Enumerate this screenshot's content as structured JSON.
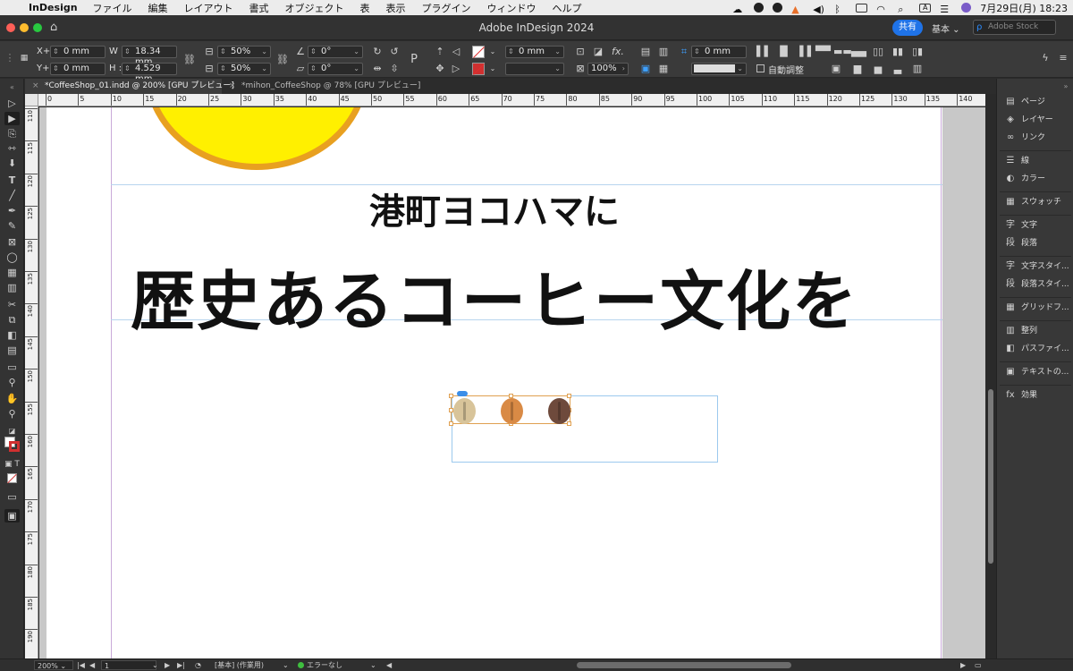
{
  "menubar": {
    "app_name": "InDesign",
    "items": [
      "ファイル",
      "編集",
      "レイアウト",
      "書式",
      "オブジェクト",
      "表",
      "表示",
      "プラグイン",
      "ウィンドウ",
      "ヘルプ"
    ],
    "input_indicator": "A",
    "datetime": "7月29日(月)  18:23"
  },
  "titlebar": {
    "title": "Adobe InDesign 2024",
    "share_label": "共有",
    "workspace": "基本",
    "stock_placeholder": "Adobe Stock"
  },
  "control": {
    "x_label": "X+",
    "x_value": "0 mm",
    "y_label": "Y+",
    "y_value": "0 mm",
    "w_label": "W :",
    "w_value": "18.34 mm",
    "h_label": "H :",
    "h_value": "4.529 mm",
    "scale_x": "50%",
    "scale_y": "50%",
    "rotate": "0°",
    "shear": "0°",
    "stroke_weight": "0 mm",
    "frame_weight": "0 mm",
    "opacity": "100%",
    "auto_fit_label": "自動調整"
  },
  "tabs": [
    {
      "label": "*CoffeeShop_01.indd @ 200% [GPU プレビュー]",
      "active": true
    },
    {
      "label": "*mihon_CoffeeShop @ 78% [GPU プレビュー]",
      "active": false
    }
  ],
  "ruler_top": [
    "0",
    "5",
    "10",
    "15",
    "20",
    "25",
    "30",
    "35",
    "40",
    "45",
    "50",
    "55",
    "60",
    "65",
    "70",
    "75",
    "80",
    "85",
    "90",
    "95",
    "100",
    "105",
    "110",
    "115",
    "120",
    "125",
    "130",
    "135",
    "140"
  ],
  "ruler_left": [
    "110",
    "115",
    "120",
    "125",
    "130",
    "135",
    "140",
    "145",
    "150",
    "155",
    "160",
    "165",
    "170",
    "175",
    "180",
    "185",
    "190"
  ],
  "document": {
    "heading_small": "港町ヨコハマに",
    "heading_large": "歴史あるコーヒー文化を",
    "bean_colors": [
      "#d8c49a",
      "#d98a45",
      "#6e4a3c"
    ],
    "sun_fill": "#fff000",
    "sun_stroke": "#e8a020"
  },
  "panels": [
    {
      "icon": "pages-icon",
      "glyph": "▤",
      "label": "ページ"
    },
    {
      "icon": "layers-icon",
      "glyph": "◈",
      "label": "レイヤー"
    },
    {
      "icon": "links-icon",
      "glyph": "∞",
      "label": "リンク"
    },
    {
      "icon": "stroke-icon",
      "glyph": "☰",
      "label": "線"
    },
    {
      "icon": "color-icon",
      "glyph": "◐",
      "label": "カラー"
    },
    {
      "icon": "swatches-icon",
      "glyph": "▦",
      "label": "スウォッチ"
    },
    {
      "icon": "character-icon",
      "glyph": "字",
      "label": "文字"
    },
    {
      "icon": "paragraph-icon",
      "glyph": "段",
      "label": "段落"
    },
    {
      "icon": "character-styles-icon",
      "glyph": "字",
      "label": "文字スタイ..."
    },
    {
      "icon": "paragraph-styles-icon",
      "glyph": "段",
      "label": "段落スタイ..."
    },
    {
      "icon": "grid-format-icon",
      "glyph": "▦",
      "label": "グリッドフ..."
    },
    {
      "icon": "align-icon",
      "glyph": "▥",
      "label": "整列"
    },
    {
      "icon": "pathfinder-icon",
      "glyph": "◧",
      "label": "パスファイ..."
    },
    {
      "icon": "text-wrap-icon",
      "glyph": "▣",
      "label": "テキストの..."
    },
    {
      "icon": "effects-icon",
      "glyph": "fx",
      "label": "効果"
    }
  ],
  "status": {
    "zoom": "200%",
    "page": "1",
    "preflight_profile": "[基本] (作業用)",
    "error_text": "エラーなし"
  }
}
